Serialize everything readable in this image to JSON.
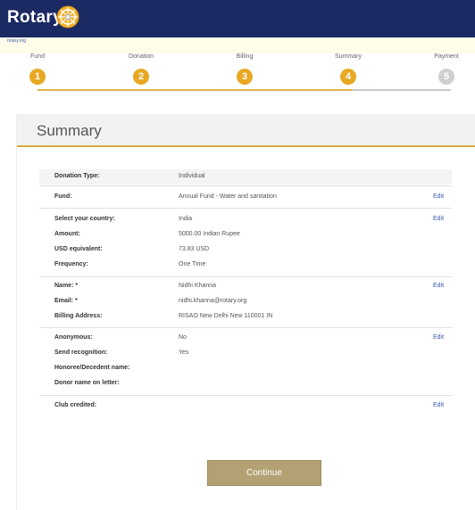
{
  "header": {
    "logo_text": "Rotary",
    "link_text": "rotary.org"
  },
  "steps": [
    {
      "label": "Fund",
      "number": "1"
    },
    {
      "label": "Donation",
      "number": "2"
    },
    {
      "label": "Billing",
      "number": "3"
    },
    {
      "label": "Summary",
      "number": "4"
    },
    {
      "label": "Payment",
      "number": "5"
    }
  ],
  "summary": {
    "title": "Summary",
    "rows": [
      {
        "label": "Donation Type:",
        "value": "Individual",
        "edit": ""
      },
      {
        "label": "Fund:",
        "value": "Annual Fund - Water and sanitation",
        "edit": "Edit"
      },
      {
        "label": "Select your country:",
        "value": "India",
        "edit": "Edit"
      },
      {
        "label": "Amount:",
        "value": "5000.00 Indian Rupee",
        "edit": ""
      },
      {
        "label": "USD equivalent:",
        "value": "73.83 USD",
        "edit": ""
      },
      {
        "label": "Frequency:",
        "value": "One Time",
        "edit": ""
      },
      {
        "label": "Name: *",
        "value": "Nidhi Khanna",
        "edit": "Edit"
      },
      {
        "label": "Email: *",
        "value": "nidhi.khanna@rotary.org",
        "edit": ""
      },
      {
        "label": "Billing Address:",
        "value": "RISAO New Delhi New 110001 IN",
        "edit": ""
      },
      {
        "label": "Anonymous:",
        "value": "No",
        "edit": "Edit"
      },
      {
        "label": "Send recognition:",
        "value": "Yes",
        "edit": ""
      },
      {
        "label": "Honoree/Decedent name:",
        "value": "",
        "edit": ""
      },
      {
        "label": "Donor name on letter:",
        "value": "",
        "edit": ""
      },
      {
        "label": "Club credited:",
        "value": "",
        "edit": "Edit"
      }
    ]
  },
  "continue_label": "Continue",
  "colors": {
    "header": "#1b2a63",
    "accent": "#e8a824",
    "button": "#b3a174"
  }
}
